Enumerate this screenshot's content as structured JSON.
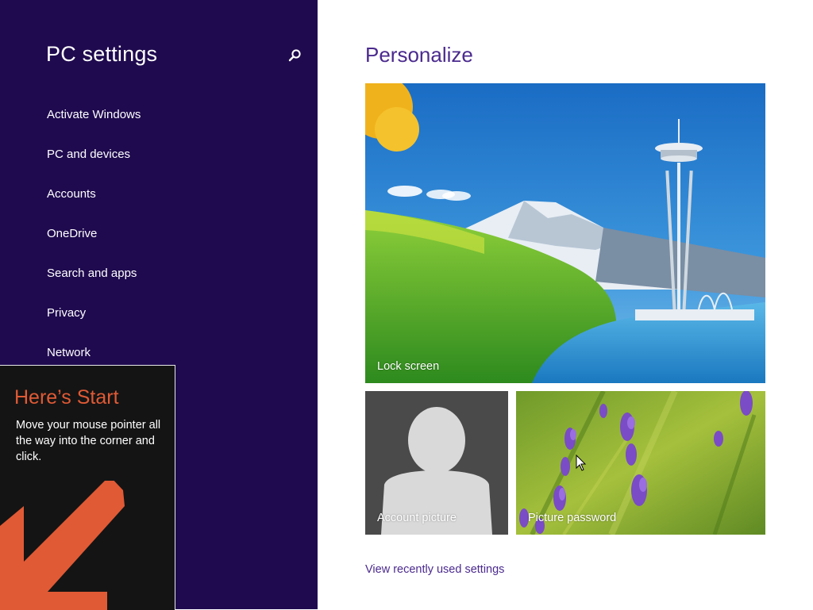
{
  "sidebar": {
    "title": "PC settings",
    "search_icon": "search-icon",
    "items": [
      {
        "label": "Activate Windows"
      },
      {
        "label": "PC and devices"
      },
      {
        "label": "Accounts"
      },
      {
        "label": "OneDrive"
      },
      {
        "label": "Search and apps"
      },
      {
        "label": "Privacy"
      },
      {
        "label": "Network"
      }
    ]
  },
  "tip": {
    "title": "Here’s Start",
    "body": "Move your mouse pointer all the way into the corner and click.",
    "arrow_icon": "arrow-down-left-icon"
  },
  "main": {
    "title": "Personalize",
    "tiles": {
      "lock_screen": "Lock screen",
      "account_picture": "Account picture",
      "picture_password": "Picture password"
    },
    "recent_link": "View recently used settings"
  },
  "colors": {
    "sidebar_bg": "#1f0a4f",
    "accent_purple": "#4b2a8e",
    "tip_accent": "#e05a35",
    "tip_bg": "#141414"
  }
}
